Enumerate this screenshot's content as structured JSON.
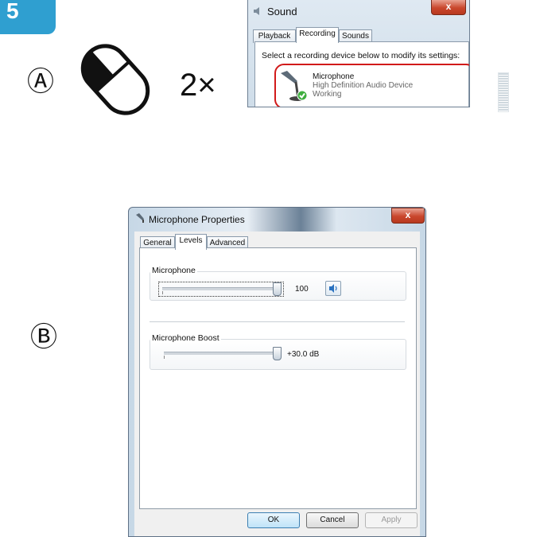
{
  "step_number": "5",
  "step_a_marker": "Ⓐ",
  "step_b_marker": "Ⓑ",
  "click_count": "2×",
  "sound_window": {
    "title": "Sound",
    "close_label": "x",
    "tabs": [
      "Playback",
      "Recording",
      "Sounds"
    ],
    "active_tab": "Recording",
    "instruction": "Select a recording device below to modify its settings:",
    "device": {
      "name": "Microphone",
      "description": "High Definition Audio Device",
      "status": "Working"
    }
  },
  "properties_window": {
    "title": "Microphone Properties",
    "close_label": "x",
    "tabs": [
      "General",
      "Levels",
      "Advanced"
    ],
    "active_tab": "Levels",
    "microphone": {
      "label": "Microphone",
      "value": "100",
      "level": 1.0
    },
    "boost": {
      "label": "Microphone Boost",
      "value": "+30.0 dB",
      "level": 1.0
    },
    "buttons": {
      "ok": "OK",
      "cancel": "Cancel",
      "apply": "Apply"
    }
  },
  "colors": {
    "badge": "#2f9fd0",
    "highlight": "#d11a1a",
    "close": "#c9472d"
  },
  "icons": [
    "mouse-left-click-icon",
    "microphone-icon",
    "check-badge-icon",
    "speaker-icon"
  ]
}
